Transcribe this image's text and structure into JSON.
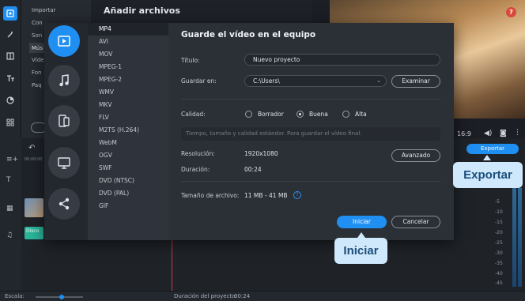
{
  "background": {
    "sidebar_items": [
      "Importar",
      "Con",
      "Son",
      "Mús",
      "Víde",
      "Fon",
      "Paq"
    ],
    "panel_title": "Añadir archivos",
    "help_label": "?",
    "aspect_ratio": "16:9",
    "db_levels": [
      "-5",
      "-10",
      "-15",
      "-20",
      "-25",
      "-30",
      "-35",
      "-40",
      "-45",
      "-50"
    ],
    "clip_label": "Disco",
    "export_button": "Exportar",
    "scale_label": "Escala:",
    "project_duration_label": "Duración del proyecto:",
    "project_duration_value": "00:24",
    "timeline_time": "00:00:00"
  },
  "formats": {
    "categories": [
      "video-icon",
      "audio-icon",
      "devices-icon",
      "tv-icon",
      "share-icon"
    ],
    "items": [
      "MP4",
      "AVI",
      "MOV",
      "MPEG-1",
      "MPEG-2",
      "WMV",
      "MKV",
      "FLV",
      "M2TS (H.264)",
      "WebM",
      "OGV",
      "SWF",
      "DVD (NTSC)",
      "DVD (PAL)",
      "GIF"
    ],
    "selected": "MP4"
  },
  "dialog": {
    "title": "Guarde el vídeo en el equipo",
    "title_label": "Título:",
    "title_value": "Nuevo proyecto",
    "save_in_label": "Guardar en:",
    "save_in_value": "C:\\Users\\",
    "browse_button": "Examinar",
    "quality_label": "Calidad:",
    "quality_options": [
      "Borrador",
      "Buena",
      "Alta"
    ],
    "quality_selected": "Buena",
    "quality_description": "Tiempo, tamaño y calidad estándar. Para guardar el vídeo final.",
    "resolution_label": "Resolución:",
    "resolution_value": "1920x1080",
    "duration_label": "Duración:",
    "duration_value": "00:24",
    "advanced_button": "Avanzado",
    "filesize_label": "Tamaño de archivo:",
    "filesize_value": "11 MB - 41 MB",
    "start_button": "Iniciar",
    "cancel_button": "Cancelar"
  },
  "callouts": {
    "export": "Exportar",
    "start": "Iniciar"
  },
  "colors": {
    "accent": "#1f8ff2",
    "callout_bg": "#cfe8fb"
  }
}
